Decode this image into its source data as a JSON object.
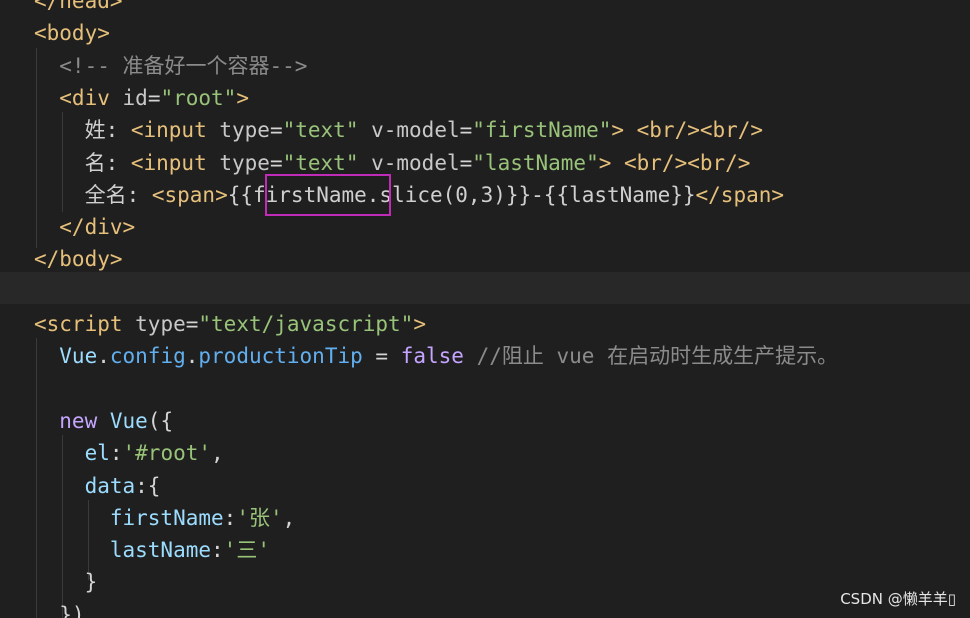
{
  "editor": {
    "lines": [
      {
        "segments": [
          {
            "c": "tag",
            "t": "</head>"
          }
        ]
      },
      {
        "segments": [
          {
            "c": "tag",
            "t": "<body>"
          }
        ]
      },
      {
        "segments": [
          {
            "c": "cmt",
            "t": "  <!-- 准备好一个容器-->"
          }
        ]
      },
      {
        "segments": [
          {
            "c": "tag",
            "t": "  <div "
          },
          {
            "c": "attr",
            "t": "id"
          },
          {
            "c": "punc",
            "t": "="
          },
          {
            "c": "str",
            "t": "\"root\""
          },
          {
            "c": "tag",
            "t": ">"
          }
        ]
      },
      {
        "segments": [
          {
            "c": "plain",
            "t": "    姓: "
          },
          {
            "c": "tag",
            "t": "<input "
          },
          {
            "c": "attr",
            "t": "type"
          },
          {
            "c": "punc",
            "t": "="
          },
          {
            "c": "str",
            "t": "\"text\""
          },
          {
            "c": "attr",
            "t": " v-model"
          },
          {
            "c": "punc",
            "t": "="
          },
          {
            "c": "str",
            "t": "\"firstName\""
          },
          {
            "c": "tag",
            "t": "> <br/><br/>"
          }
        ]
      },
      {
        "segments": [
          {
            "c": "plain",
            "t": "    名: "
          },
          {
            "c": "tag",
            "t": "<input "
          },
          {
            "c": "attr",
            "t": "type"
          },
          {
            "c": "punc",
            "t": "="
          },
          {
            "c": "str",
            "t": "\"text\""
          },
          {
            "c": "attr",
            "t": " v-model"
          },
          {
            "c": "punc",
            "t": "="
          },
          {
            "c": "str",
            "t": "\"lastName\""
          },
          {
            "c": "tag",
            "t": "> <br/><br/>"
          }
        ]
      },
      {
        "segments": [
          {
            "c": "plain",
            "t": "    全名: "
          },
          {
            "c": "tag",
            "t": "<span>"
          },
          {
            "c": "plain",
            "t": "{{firstName.slice(0,3)}}-{{lastName}}"
          },
          {
            "c": "tag",
            "t": "</span>"
          }
        ]
      },
      {
        "segments": [
          {
            "c": "tag",
            "t": "  </div>"
          }
        ]
      },
      {
        "segments": [
          {
            "c": "tag",
            "t": "</body>"
          }
        ]
      },
      {
        "segments": [
          {
            "c": "plain",
            "t": ""
          }
        ]
      },
      {
        "segments": [
          {
            "c": "tag",
            "t": "<script "
          },
          {
            "c": "attr",
            "t": "type"
          },
          {
            "c": "punc",
            "t": "="
          },
          {
            "c": "str",
            "t": "\"text/javascript\""
          },
          {
            "c": "tag",
            "t": ">"
          }
        ]
      },
      {
        "segments": [
          {
            "c": "ident",
            "t": "  Vue"
          },
          {
            "c": "punc",
            "t": "."
          },
          {
            "c": "prop",
            "t": "config"
          },
          {
            "c": "punc",
            "t": "."
          },
          {
            "c": "prop",
            "t": "productionTip"
          },
          {
            "c": "punc",
            "t": " = "
          },
          {
            "c": "kw",
            "t": "false"
          },
          {
            "c": "cmt",
            "t": " //阻止 vue 在启动时生成生产提示。"
          }
        ]
      },
      {
        "segments": [
          {
            "c": "plain",
            "t": ""
          }
        ]
      },
      {
        "segments": [
          {
            "c": "kw",
            "t": "  new "
          },
          {
            "c": "ident",
            "t": "Vue"
          },
          {
            "c": "punc",
            "t": "({"
          }
        ]
      },
      {
        "segments": [
          {
            "c": "ident",
            "t": "    el"
          },
          {
            "c": "punc",
            "t": ":"
          },
          {
            "c": "str",
            "t": "'#root'"
          },
          {
            "c": "punc",
            "t": ","
          }
        ]
      },
      {
        "segments": [
          {
            "c": "ident",
            "t": "    data"
          },
          {
            "c": "punc",
            "t": ":{"
          }
        ]
      },
      {
        "segments": [
          {
            "c": "ident",
            "t": "      firstName"
          },
          {
            "c": "punc",
            "t": ":"
          },
          {
            "c": "str",
            "t": "'张'"
          },
          {
            "c": "punc",
            "t": ","
          }
        ]
      },
      {
        "segments": [
          {
            "c": "ident",
            "t": "      lastName"
          },
          {
            "c": "punc",
            "t": ":"
          },
          {
            "c": "str",
            "t": "'三'"
          }
        ]
      },
      {
        "segments": [
          {
            "c": "punc",
            "t": "    }"
          }
        ]
      },
      {
        "segments": [
          {
            "c": "punc",
            "t": "  })"
          }
        ]
      }
    ]
  },
  "colors": {
    "background": "#1f1f1f",
    "highlight_border": "#c02bb8"
  },
  "watermark": "CSDN @懒羊羊▯"
}
